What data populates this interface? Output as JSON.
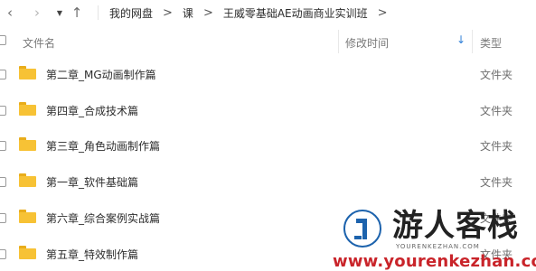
{
  "nav": {
    "back_glyph": "‹",
    "forward_glyph": "›",
    "dropdown_glyph": "▼",
    "up_glyph": "↑",
    "separator_glyph": ">",
    "breadcrumbs": [
      "我的网盘",
      "课",
      "王威零基础AE动画商业实训班"
    ]
  },
  "list_header": {
    "name": "文件名",
    "modified": "修改时间",
    "type": "类型",
    "sort_glyph": "↓"
  },
  "rows": [
    {
      "name": "第二章_MG动画制作篇",
      "type": "文件夹"
    },
    {
      "name": "第四章_合成技术篇",
      "type": "文件夹"
    },
    {
      "name": "第三章_角色动画制作篇",
      "type": "文件夹"
    },
    {
      "name": "第一章_软件基础篇",
      "type": "文件夹"
    },
    {
      "name": "第六章_综合案例实战篇",
      "type": "文件夹"
    },
    {
      "name": "第五章_特效制作篇",
      "type": "文件夹"
    }
  ],
  "watermark": {
    "title": "游人客栈",
    "subtitle": "YOURENKEZHAN.COM",
    "url": "www.yourenkezhan.com"
  },
  "colors": {
    "folder_body": "#f7c235",
    "folder_tab": "#e9ad1b",
    "sort_accent": "#2f7fd8",
    "watermark_url": "#c9242a",
    "logo_blue": "#1d63ad"
  }
}
